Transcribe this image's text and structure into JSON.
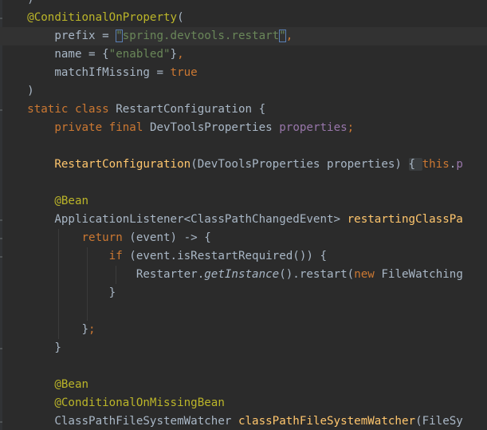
{
  "colors": {
    "background": "#2b2b2b",
    "current_line": "#323232",
    "annotation": "#bbb529",
    "keyword": "#cc7832",
    "string": "#6a8759",
    "field": "#9876aa",
    "method_decl": "#ffc66d",
    "plain": "#a9b7c6"
  },
  "lines": [
    {
      "tokens": [
        {
          "t": "plain",
          "v": "    )"
        }
      ]
    },
    {
      "tokens": [
        {
          "t": "plain",
          "v": "    "
        },
        {
          "t": "annotation",
          "v": "@ConditionalOnProperty"
        },
        {
          "t": "plain",
          "v": "("
        }
      ]
    },
    {
      "current": true,
      "tokens": [
        {
          "t": "plain",
          "v": "        prefix = "
        },
        {
          "t": "string",
          "v": "\"spring.devtools.restart\"",
          "hl": true
        },
        {
          "t": "keyword",
          "v": ","
        }
      ]
    },
    {
      "tokens": [
        {
          "t": "plain",
          "v": "        name = {"
        },
        {
          "t": "string",
          "v": "\"enabled\""
        },
        {
          "t": "plain",
          "v": "}"
        },
        {
          "t": "keyword",
          "v": ","
        }
      ]
    },
    {
      "tokens": [
        {
          "t": "plain",
          "v": "        matchIfMissing = "
        },
        {
          "t": "keyword",
          "v": "true"
        }
      ]
    },
    {
      "tokens": [
        {
          "t": "plain",
          "v": "    )"
        }
      ]
    },
    {
      "tokens": [
        {
          "t": "plain",
          "v": "    "
        },
        {
          "t": "keyword",
          "v": "static class "
        },
        {
          "t": "plain",
          "v": "RestartConfiguration {"
        }
      ]
    },
    {
      "tokens": [
        {
          "t": "plain",
          "v": "        "
        },
        {
          "t": "keyword",
          "v": "private final "
        },
        {
          "t": "plain",
          "v": "DevToolsProperties "
        },
        {
          "t": "field",
          "v": "properties"
        },
        {
          "t": "keyword",
          "v": ";"
        }
      ]
    },
    {
      "tokens": [
        {
          "t": "plain",
          "v": ""
        }
      ]
    },
    {
      "tokens": [
        {
          "t": "plain",
          "v": "        "
        },
        {
          "t": "method",
          "v": "RestartConfiguration"
        },
        {
          "t": "plain",
          "v": "(DevToolsProperties properties) "
        },
        {
          "t": "plain",
          "v": "{ ",
          "fold": true
        },
        {
          "t": "keyword",
          "v": "this"
        },
        {
          "t": "plain",
          "v": "."
        },
        {
          "t": "field",
          "v": "p"
        }
      ]
    },
    {
      "tokens": [
        {
          "t": "plain",
          "v": ""
        }
      ]
    },
    {
      "tokens": [
        {
          "t": "plain",
          "v": "        "
        },
        {
          "t": "annotation",
          "v": "@Bean"
        }
      ]
    },
    {
      "tokens": [
        {
          "t": "plain",
          "v": "        ApplicationListener<ClassPathChangedEvent> "
        },
        {
          "t": "method",
          "v": "restartingClassPa"
        }
      ]
    },
    {
      "tokens": [
        {
          "t": "plain",
          "v": "            "
        },
        {
          "t": "keyword",
          "v": "return "
        },
        {
          "t": "plain",
          "v": "(event) -> {"
        }
      ]
    },
    {
      "tokens": [
        {
          "t": "plain",
          "v": "                "
        },
        {
          "t": "keyword",
          "v": "if "
        },
        {
          "t": "plain",
          "v": "(event.isRestartRequired()) {"
        }
      ]
    },
    {
      "tokens": [
        {
          "t": "plain",
          "v": "                    Restarter."
        },
        {
          "t": "plain",
          "v": "getInstance",
          "italic": true
        },
        {
          "t": "plain",
          "v": "().restart("
        },
        {
          "t": "keyword",
          "v": "new "
        },
        {
          "t": "plain",
          "v": "FileWatching"
        }
      ]
    },
    {
      "tokens": [
        {
          "t": "plain",
          "v": "                }"
        }
      ]
    },
    {
      "tokens": [
        {
          "t": "plain",
          "v": ""
        }
      ]
    },
    {
      "tokens": [
        {
          "t": "plain",
          "v": "            }"
        },
        {
          "t": "keyword",
          "v": ";"
        }
      ]
    },
    {
      "tokens": [
        {
          "t": "plain",
          "v": "        }"
        }
      ]
    },
    {
      "tokens": [
        {
          "t": "plain",
          "v": ""
        }
      ]
    },
    {
      "tokens": [
        {
          "t": "plain",
          "v": "        "
        },
        {
          "t": "annotation",
          "v": "@Bean"
        }
      ]
    },
    {
      "tokens": [
        {
          "t": "plain",
          "v": "        "
        },
        {
          "t": "annotation",
          "v": "@ConditionalOnMissingBean"
        }
      ]
    },
    {
      "tokens": [
        {
          "t": "plain",
          "v": "        ClassPathFileSystemWatcher "
        },
        {
          "t": "method",
          "v": "classPathFileSystemWatcher"
        },
        {
          "t": "plain",
          "v": "(FileSy"
        }
      ]
    }
  ]
}
